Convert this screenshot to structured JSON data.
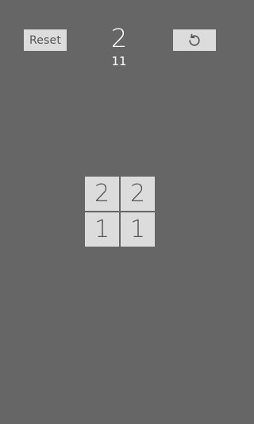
{
  "header": {
    "reset_label": "Reset",
    "level": "2",
    "moves": "11",
    "undo_icon": "undo-icon"
  },
  "board": {
    "tiles": [
      "2",
      "2",
      "1",
      "1"
    ]
  },
  "colors": {
    "background": "#666666",
    "tile": "#dcdcdc",
    "tile_text": "#555555",
    "header_text": "#ffffff"
  }
}
